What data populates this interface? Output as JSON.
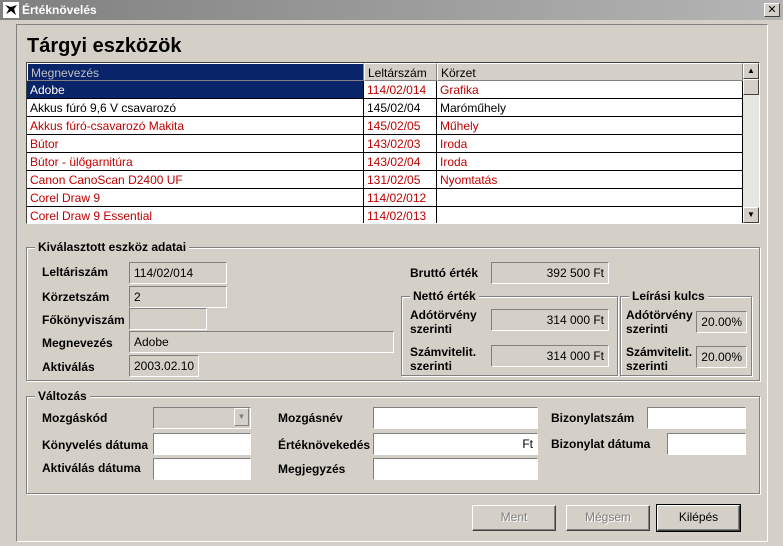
{
  "window": {
    "title": "Értéknövelés",
    "close_glyph": "✕"
  },
  "page_title": "Tárgyi eszközök",
  "table": {
    "columns": [
      "Megnevezés",
      "Leltárszám",
      "Körzet"
    ],
    "rows": [
      {
        "name": "Adobe",
        "id": "114/02/014",
        "zone": "Grafika"
      },
      {
        "name": "Akkus fúró 9,6 V csavarozó",
        "id": "145/02/04",
        "zone": "Maróműhely"
      },
      {
        "name": "Akkus fúró-csavarozó Makita",
        "id": "145/02/05",
        "zone": "Műhely"
      },
      {
        "name": "Bútor",
        "id": "143/02/03",
        "zone": "Iroda"
      },
      {
        "name": "Bútor - ülőgarnitúra",
        "id": "143/02/04",
        "zone": "Iroda"
      },
      {
        "name": "Canon CanoScan D2400 UF",
        "id": "131/02/05",
        "zone": "Nyomtatás"
      },
      {
        "name": "Corel Draw 9",
        "id": "114/02/012",
        "zone": ""
      },
      {
        "name": "Corel Draw 9 Essential",
        "id": "114/02/013",
        "zone": ""
      }
    ]
  },
  "selected": {
    "group_label": "Kiválasztott eszköz adatai",
    "inventory_label": "Leltáriszám",
    "inventory_value": "114/02/014",
    "zone_label": "Körzetszám",
    "zone_value": "2",
    "ledger_label": "Főkönyviszám",
    "ledger_value": "",
    "name_label": "Megnevezés",
    "name_value": "Adobe",
    "activation_label": "Aktiválás",
    "activation_value": "2003.02.10",
    "gross_label": "Bruttó érték",
    "gross_value": "392 500 Ft",
    "net_group_label": "Nettó érték",
    "net_tax_label_1": "Adótörvény",
    "net_tax_label_2": "szerinti",
    "net_tax_value": "314 000 Ft",
    "net_acc_label_1": "Számvitelit.",
    "net_acc_label_2": "szerinti",
    "net_acc_value": "314 000 Ft",
    "rate_group_label": "Leírási kulcs",
    "rate_tax_label_1": "Adótörvény",
    "rate_tax_label_2": "szerinti",
    "rate_tax_value": "20.00%",
    "rate_acc_label_1": "Számvitelit.",
    "rate_acc_label_2": "szerinti",
    "rate_acc_value": "20.00%"
  },
  "change": {
    "group_label": "Változás",
    "move_code_label": "Mozgáskód",
    "move_code_value": "",
    "move_name_label": "Mozgásnév",
    "move_name_value": "",
    "doc_no_label": "Bizonylatszám",
    "doc_no_value": "",
    "booking_date_label": "Könyvelés dátuma",
    "booking_date_value": "",
    "increase_label": "Értéknövekedés",
    "increase_value": "Ft",
    "doc_date_label": "Bizonylat dátuma",
    "doc_date_value": "",
    "act_date_label": "Aktiválás dátuma",
    "act_date_value": "",
    "note_label": "Megjegyzés",
    "note_value": ""
  },
  "buttons": {
    "save": "Ment",
    "cancel": "Mégsem",
    "exit": "Kilépés"
  },
  "colors": {
    "red_text": "#c00000",
    "selection": "#0a246a"
  }
}
